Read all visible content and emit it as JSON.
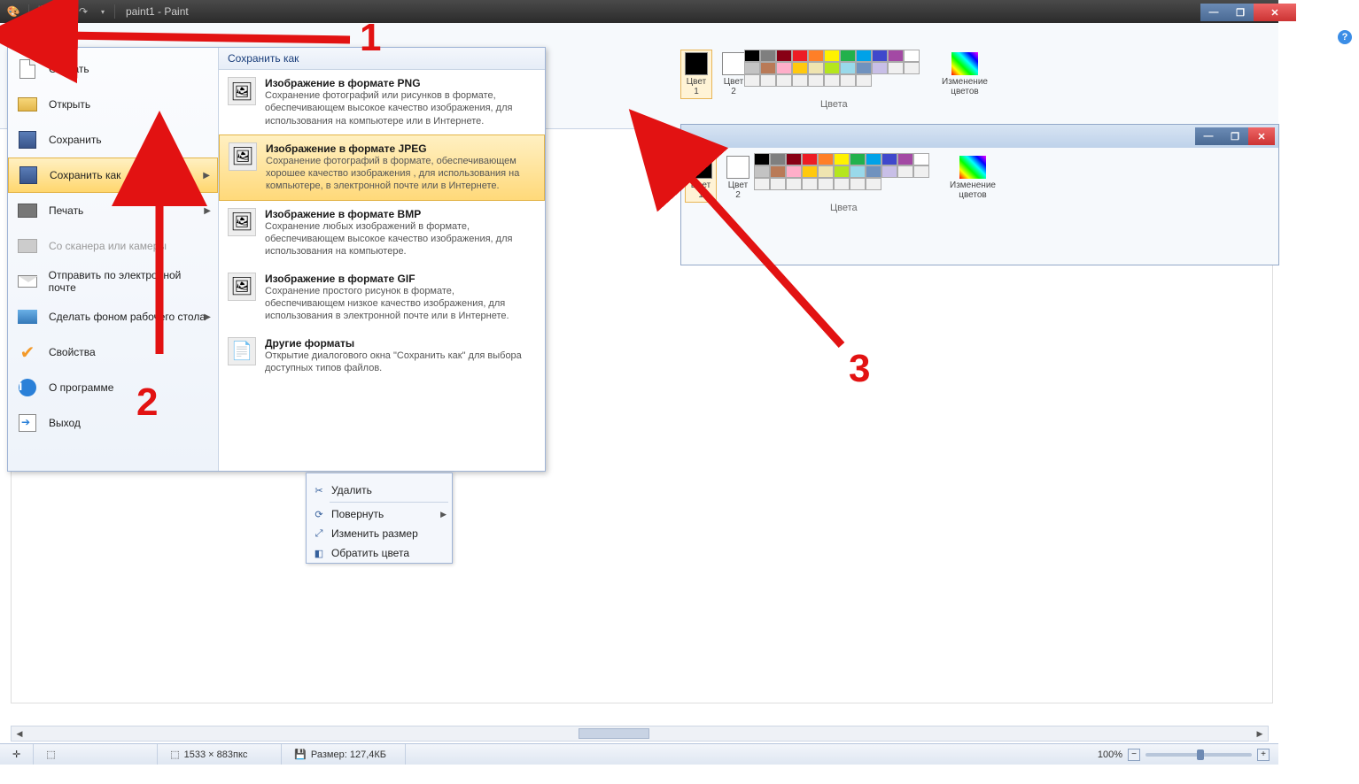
{
  "titlebar": {
    "text": "paint1 - Paint"
  },
  "win_ctrl": {
    "min": "—",
    "max": "❐",
    "close": "✕"
  },
  "file_menu": {
    "items": [
      {
        "label": "Создать",
        "icon": "new",
        "submenu": false,
        "disabled": false
      },
      {
        "label": "Открыть",
        "icon": "open",
        "submenu": false,
        "disabled": false
      },
      {
        "label": "Сохранить",
        "icon": "save",
        "submenu": false,
        "disabled": false
      },
      {
        "label": "Сохранить как",
        "icon": "save",
        "submenu": true,
        "disabled": false,
        "selected": true
      },
      {
        "label": "Печать",
        "icon": "print",
        "submenu": true,
        "disabled": false
      },
      {
        "label": "Со сканера или камеры",
        "icon": "scan",
        "submenu": false,
        "disabled": true
      },
      {
        "label": "Отправить по электронной почте",
        "icon": "mail",
        "submenu": false,
        "disabled": false
      },
      {
        "label": "Сделать фоном рабочего стола",
        "icon": "desk",
        "submenu": true,
        "disabled": false
      },
      {
        "label": "Свойства",
        "icon": "prop",
        "submenu": false,
        "disabled": false
      },
      {
        "label": "О программе",
        "icon": "info",
        "submenu": false,
        "disabled": false
      },
      {
        "label": "Выход",
        "icon": "exit",
        "submenu": false,
        "disabled": false
      }
    ]
  },
  "saveas_panel": {
    "header": "Сохранить как",
    "options": [
      {
        "title": "Изображение в формате PNG",
        "desc": "Сохранение фотографий или рисунков в формате, обеспечивающем высокое качество изображения, для использования на компьютере или в Интернете."
      },
      {
        "title": "Изображение в формате JPEG",
        "desc": "Сохранение фотографий в формате, обеспечивающем хорошее качество изображения , для использования на компьютере, в электронной почте или в Интернете.",
        "selected": true
      },
      {
        "title": "Изображение в формате BMP",
        "desc": "Сохранение любых изображений в формате, обеспечивающем высокое качество изображения, для использования на компьютере."
      },
      {
        "title": "Изображение в формате GIF",
        "desc": "Сохранение простого рисунок в формате, обеспечивающем низкое качество изображения, для использования в электронной почте или в Интернете."
      },
      {
        "title": "Другие форматы",
        "desc": "Открытие диалогового окна \"Сохранить как\" для выбора доступных типов файлов."
      }
    ]
  },
  "ribbon": {
    "color1_label": "Цвет\n1",
    "color2_label": "Цвет\n2",
    "edit_colors": "Изменение\nцветов",
    "group_label": "Цвета",
    "palette_row1": [
      "#000000",
      "#7f7f7f",
      "#880015",
      "#ed1c24",
      "#ff7f27",
      "#fff200",
      "#22b14c",
      "#00a2e8",
      "#3f48cc",
      "#a349a4"
    ],
    "palette_row2": [
      "#ffffff",
      "#c3c3c3",
      "#b97a57",
      "#ffaec9",
      "#ffc90e",
      "#efe4b0",
      "#b5e61d",
      "#99d9ea",
      "#7092be",
      "#c8bfe7"
    ],
    "palette_row3": [
      "#f0f0f0",
      "#f0f0f0",
      "#f0f0f0",
      "#f0f0f0",
      "#f0f0f0",
      "#f0f0f0",
      "#f0f0f0",
      "#f0f0f0",
      "#f0f0f0",
      "#f0f0f0"
    ]
  },
  "sec_ribbon": {
    "color1_label": "Цвет\n1",
    "color2_label": "Цвет\n2",
    "edit_colors": "Изменение\nцветов",
    "group_label": "Цвета"
  },
  "context_menu": {
    "items": [
      {
        "label": "Удалить",
        "icon": "✂"
      },
      {
        "label": "Повернуть",
        "icon": "⟳",
        "submenu": true
      },
      {
        "label": "Изменить размер",
        "icon": "⤢"
      },
      {
        "label": "Обратить цвета",
        "icon": "◧"
      }
    ]
  },
  "status": {
    "dims": "1533 × 883пкс",
    "size_label": "Размер: 127,4КБ",
    "zoom": "100%"
  },
  "annotations": {
    "n1": "1",
    "n2": "2",
    "n3": "3"
  }
}
